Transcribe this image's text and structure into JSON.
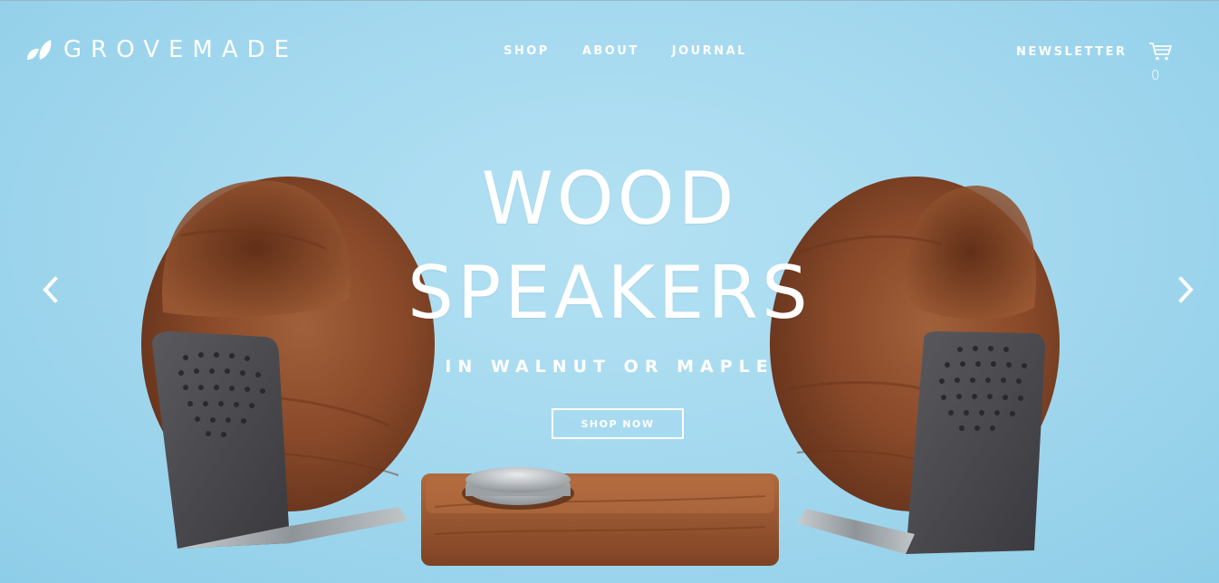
{
  "header": {
    "logo_text": "GROVEMADE",
    "nav": [
      {
        "label": "SHOP"
      },
      {
        "label": "ABOUT"
      },
      {
        "label": "JOURNAL"
      }
    ],
    "newsletter_label": "NEWSLETTER",
    "cart_count": "0"
  },
  "hero": {
    "headline_line1": "WOOD",
    "headline_line2": "SPEAKERS",
    "subhead": "IN WALNUT OR MAPLE",
    "cta_label": "SHOP NOW"
  },
  "icons": {
    "logo": "leaf-logo-icon",
    "cart": "shopping-cart-icon",
    "prev": "chevron-left-icon",
    "next": "chevron-right-icon"
  },
  "colors": {
    "background": "#a5d9ef",
    "text": "#ffffff",
    "walnut": "#8a4a2a",
    "metal": "#4c4c50"
  }
}
